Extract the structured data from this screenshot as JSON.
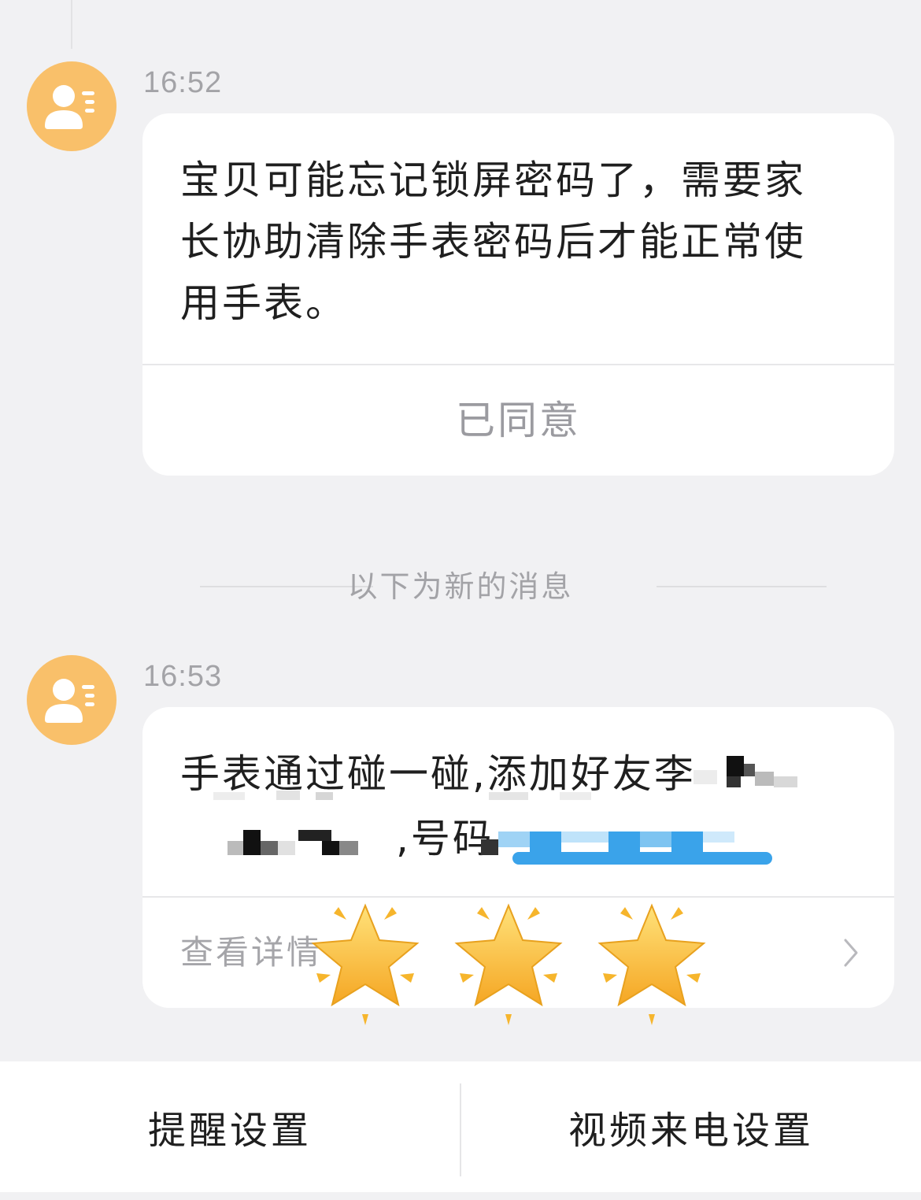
{
  "messages": [
    {
      "time": "16:52",
      "text": "宝贝可能忘记锁屏密码了，需要家长协助清除手表密码后才能正常使用手表。",
      "action_label": "已同意"
    },
    {
      "time": "16:53",
      "text_line1": "手表通过碰一碰,添加好友李",
      "text_line2": ",号码",
      "details_label": "查看详情"
    }
  ],
  "divider_label": "以下为新的消息",
  "bottom_bar": {
    "reminder_settings_label": "提醒设置",
    "video_call_settings_label": "视频来电设置"
  },
  "icons": {
    "avatar": "contact-card-icon",
    "chevron": "chevron-right-icon",
    "stars": "glowing-star-emoji"
  },
  "colors": {
    "avatar_bg": "#f9c06a",
    "page_bg": "#f1f1f3",
    "card_bg": "#ffffff",
    "muted_text": "#a3a3a7"
  }
}
